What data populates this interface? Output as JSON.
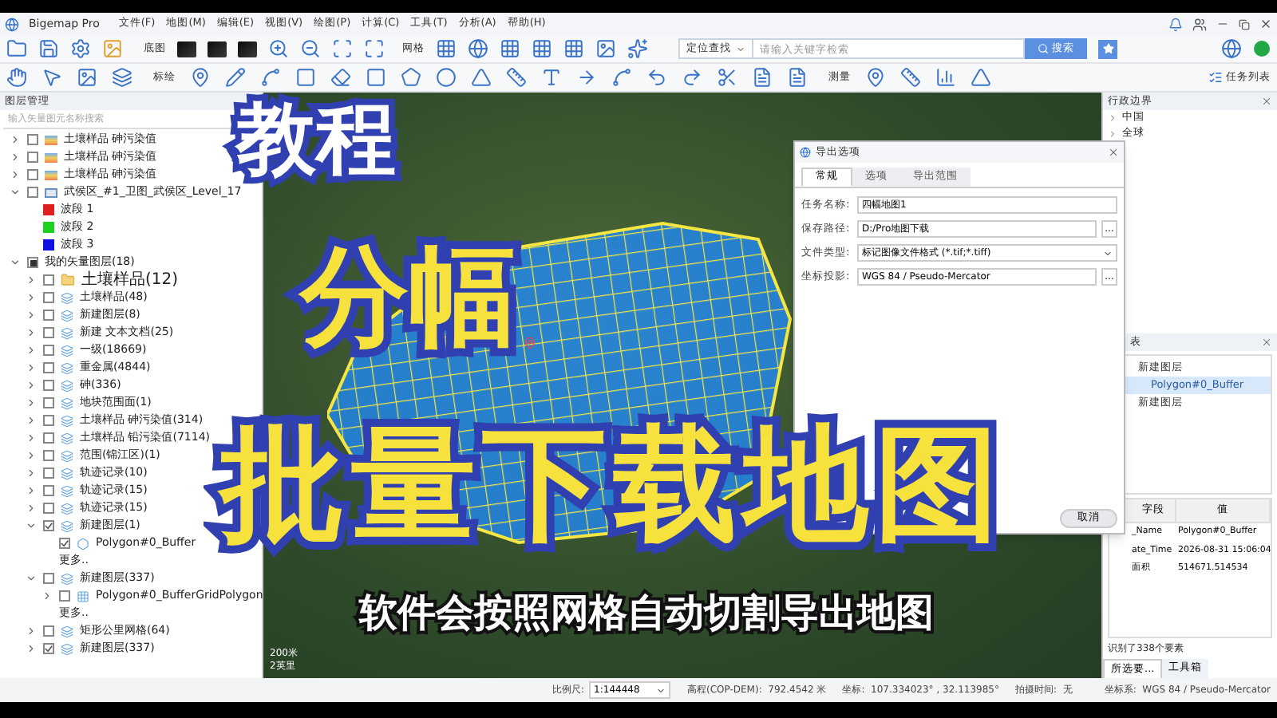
{
  "app": {
    "title": "Bigemap Pro",
    "menu": [
      "文件(F)",
      "地图(M)",
      "编辑(E)",
      "视图(V)",
      "绘图(P)",
      "计算(C)",
      "工具(T)",
      "分析(A)",
      "帮助(H)"
    ]
  },
  "toolbar": {
    "basemap_label": "底图",
    "grid_label": "网格",
    "location_select": "定位查找",
    "search": {
      "placeholder": "请输入关键字检索"
    },
    "search_button": "搜索",
    "plot_label": "标绘",
    "measure_label": "测量",
    "task_list": "任务列表"
  },
  "layer_panel": {
    "title": "图层管理",
    "search": {
      "placeholder": "输入矢量图元名称搜索"
    },
    "tree": [
      {
        "label": "土壤样品 砷污染值",
        "kind": "raster",
        "expanded": false,
        "checked": false
      },
      {
        "label": "土壤样品 砷污染值",
        "kind": "raster",
        "expanded": false,
        "checked": false
      },
      {
        "label": "土壤样品 砷污染值",
        "kind": "raster",
        "expanded": false,
        "checked": false
      },
      {
        "label": "武侯区_#1_卫图_武侯区_Level_17",
        "kind": "image",
        "expanded": true,
        "checked": false,
        "children": [
          {
            "label": "波段 1",
            "kind": "band",
            "color": "#e02020"
          },
          {
            "label": "波段 2",
            "kind": "band",
            "color": "#20d020"
          },
          {
            "label": "波段 3",
            "kind": "band",
            "color": "#1010e0"
          }
        ]
      },
      {
        "label": "我的矢量图层(18)",
        "kind": "group",
        "expanded": true,
        "mixed": true,
        "children": [
          {
            "label": "土壤样品(12)",
            "kind": "folder",
            "expanded": false,
            "checked": false
          },
          {
            "label": "土壤样品(48)",
            "kind": "vector",
            "expanded": false,
            "checked": false
          },
          {
            "label": "新建图层(8)",
            "kind": "vector",
            "expanded": false,
            "checked": false
          },
          {
            "label": "新建 文本文档(25)",
            "kind": "vector",
            "expanded": false,
            "checked": false
          },
          {
            "label": "一级(18669)",
            "kind": "vector",
            "expanded": false,
            "checked": false
          },
          {
            "label": "重金属(4844)",
            "kind": "vector",
            "expanded": false,
            "checked": false
          },
          {
            "label": "砷(336)",
            "kind": "vector",
            "expanded": false,
            "checked": false
          },
          {
            "label": "地块范围面(1)",
            "kind": "vector",
            "expanded": false,
            "checked": false
          },
          {
            "label": "土壤样品 砷污染值(314)",
            "kind": "vector",
            "expanded": false,
            "checked": false
          },
          {
            "label": "土壤样品 铅污染值(7114)",
            "kind": "vector",
            "expanded": false,
            "checked": false
          },
          {
            "label": "范围(锦江区)(1)",
            "kind": "vector",
            "expanded": false,
            "checked": false
          },
          {
            "label": "轨迹记录(10)",
            "kind": "vector",
            "expanded": false,
            "checked": false
          },
          {
            "label": "轨迹记录(15)",
            "kind": "vector",
            "expanded": false,
            "checked": false
          },
          {
            "label": "轨迹记录(15)",
            "kind": "vector",
            "expanded": false,
            "checked": false
          },
          {
            "label": "新建图层(1)",
            "kind": "vector",
            "expanded": true,
            "checked": true,
            "children": [
              {
                "label": "Polygon#0_Buffer",
                "kind": "polygon",
                "checked": true
              },
              {
                "label": "更多..",
                "kind": "more"
              }
            ]
          },
          {
            "label": "新建图层(337)",
            "kind": "vector",
            "expanded": true,
            "checked": false,
            "children": [
              {
                "label": "Polygon#0_BufferGridPolygon",
                "kind": "grid",
                "expanded": false,
                "checked": false
              },
              {
                "label": "更多..",
                "kind": "more"
              }
            ]
          },
          {
            "label": "矩形公里网格(64)",
            "kind": "vector",
            "expanded": false,
            "checked": false
          },
          {
            "label": "新建图层(337)",
            "kind": "vector",
            "expanded": false,
            "checked": true
          }
        ]
      }
    ]
  },
  "map": {
    "scale_labels": [
      "200米",
      "2英里"
    ]
  },
  "overlay": {
    "tag": "教程",
    "title": "分幅",
    "headline": "批量下载地图",
    "subtitle": "软件会按照网格自动切割导出地图"
  },
  "export_dialog": {
    "title": "导出选项",
    "tabs": [
      {
        "label": "常规",
        "selected": true
      },
      {
        "label": "选项",
        "selected": false
      },
      {
        "label": "导出范围",
        "selected": false
      }
    ],
    "fields": [
      {
        "label": "任务名称:",
        "value": "四幅地图1",
        "kind": "text"
      },
      {
        "label": "保存路径:",
        "value": "D:/Pro地图下载",
        "kind": "browse"
      },
      {
        "label": "文件类型:",
        "value": "标记图像文件格式 (*.tif;*.tiff)",
        "kind": "select"
      },
      {
        "label": "坐标投影:",
        "value": "WGS 84 / Pseudo-Mercator",
        "kind": "browse"
      }
    ],
    "browse_button": "...",
    "cancel_button": "取消"
  },
  "admin_panel": {
    "title": "行政边界",
    "items": [
      {
        "label": "中国",
        "expanded": false
      },
      {
        "label": "全球",
        "expanded": false
      }
    ]
  },
  "feature_panel": {
    "title": "表",
    "items": [
      {
        "label": "新建图层",
        "selected": false,
        "kind": "layer"
      },
      {
        "label": "Polygon#0_Buffer",
        "selected": true,
        "kind": "feature"
      },
      {
        "label": "新建图层",
        "selected": false,
        "kind": "layer"
      }
    ],
    "columns": [
      "字段",
      "值"
    ],
    "rows": [
      [
        "_Name",
        "Polygon#0_Buffer"
      ],
      [
        "ate_Time",
        "2026-08-31 15:06:04"
      ],
      [
        "面积",
        "514671.514534"
      ]
    ],
    "footer": "识别了338个要素",
    "tabs": [
      {
        "label": "所选要...",
        "selected": true
      },
      {
        "label": "工具箱",
        "selected": false
      }
    ]
  },
  "status_bar": {
    "scale_label": "比例尺:",
    "scale_value": "1:144448",
    "elevation": "高程(COP-DEM):  792.4542 米",
    "coords": "坐标:  107.334023° , 32.113985°",
    "capture_time": "拍摄时间:  无",
    "crs": "坐标系:  WGS 84 / Pseudo-Mercator"
  }
}
